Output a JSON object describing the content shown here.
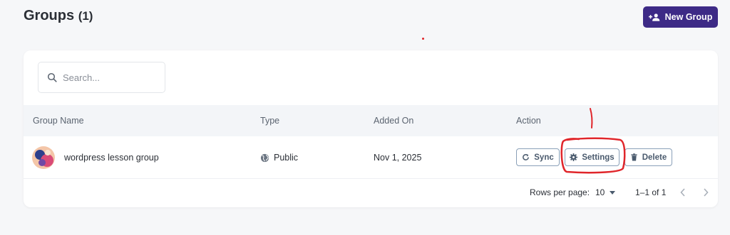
{
  "header": {
    "title": "Groups",
    "count": "(1)",
    "new_group_label": "New Group"
  },
  "search": {
    "placeholder": "Search..."
  },
  "table": {
    "columns": [
      "Group Name",
      "Type",
      "Added On",
      "Action"
    ],
    "rows": [
      {
        "name": "wordpress lesson group",
        "type": "Public",
        "added_on": "Nov 1, 2025"
      }
    ],
    "actions": {
      "sync": "Sync",
      "settings": "Settings",
      "delete": "Delete"
    }
  },
  "pagination": {
    "rows_per_page_label": "Rows per page:",
    "rows_per_page_value": "10",
    "range": "1–1 of 1"
  },
  "colors": {
    "primary": "#3d2a86",
    "annotation": "#e0262b"
  },
  "icons": [
    "add-group-icon",
    "search-icon",
    "globe-icon",
    "sync-icon",
    "gear-icon",
    "trash-icon",
    "caret-down-icon",
    "chevron-left-icon",
    "chevron-right-icon"
  ]
}
